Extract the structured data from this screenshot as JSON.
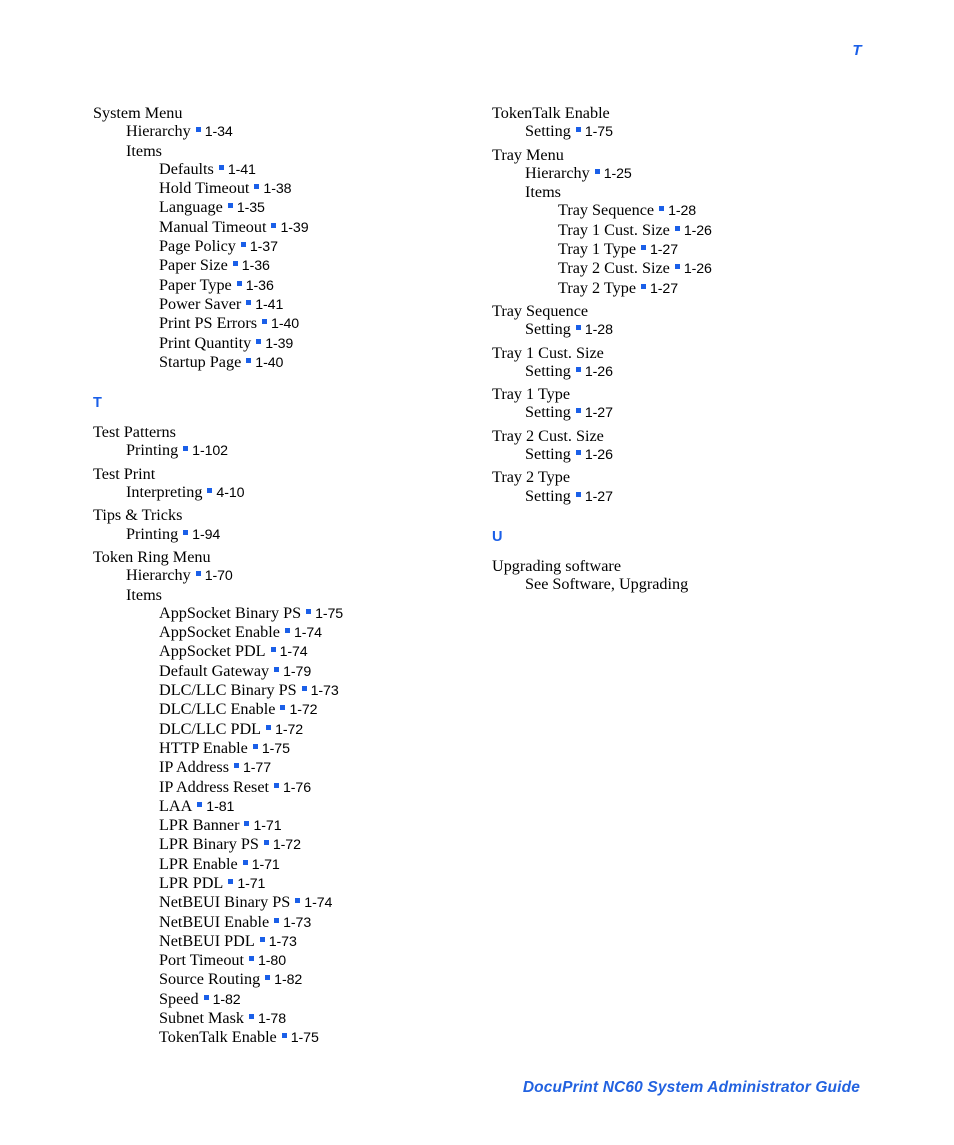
{
  "header": {
    "letter": "T"
  },
  "footer": {
    "text": "DocuPrint NC60 System Administrator Guide"
  },
  "columns": {
    "left": [
      {
        "type": "group",
        "name": "system-menu",
        "entries": [
          {
            "level": 0,
            "term": "System Menu",
            "locator": null
          },
          {
            "level": 1,
            "term": "Hierarchy",
            "locator": "1-34"
          },
          {
            "level": 1,
            "term": "Items",
            "locator": null
          },
          {
            "level": 2,
            "term": "Defaults",
            "locator": "1-41"
          },
          {
            "level": 2,
            "term": "Hold Timeout",
            "locator": "1-38"
          },
          {
            "level": 2,
            "term": "Language",
            "locator": "1-35"
          },
          {
            "level": 2,
            "term": "Manual Timeout",
            "locator": "1-39"
          },
          {
            "level": 2,
            "term": "Page Policy",
            "locator": "1-37"
          },
          {
            "level": 2,
            "term": "Paper Size",
            "locator": "1-36"
          },
          {
            "level": 2,
            "term": "Paper Type",
            "locator": "1-36"
          },
          {
            "level": 2,
            "term": "Power Saver",
            "locator": "1-41"
          },
          {
            "level": 2,
            "term": "Print PS Errors",
            "locator": "1-40"
          },
          {
            "level": 2,
            "term": "Print Quantity",
            "locator": "1-39"
          },
          {
            "level": 2,
            "term": "Startup Page",
            "locator": "1-40"
          }
        ]
      },
      {
        "type": "letter",
        "name": "section-letter-t",
        "letter": "T"
      },
      {
        "type": "group",
        "name": "test-patterns",
        "entries": [
          {
            "level": 0,
            "term": "Test Patterns",
            "locator": null
          },
          {
            "level": 1,
            "term": "Printing",
            "locator": "1-102"
          }
        ]
      },
      {
        "type": "group",
        "name": "test-print",
        "entries": [
          {
            "level": 0,
            "term": "Test Print",
            "locator": null
          },
          {
            "level": 1,
            "term": "Interpreting",
            "locator": "4-10"
          }
        ]
      },
      {
        "type": "group",
        "name": "tips-and-tricks",
        "entries": [
          {
            "level": 0,
            "term": "Tips & Tricks",
            "locator": null
          },
          {
            "level": 1,
            "term": "Printing",
            "locator": "1-94"
          }
        ]
      },
      {
        "type": "group",
        "name": "token-ring-menu",
        "entries": [
          {
            "level": 0,
            "term": "Token Ring Menu",
            "locator": null
          },
          {
            "level": 1,
            "term": "Hierarchy",
            "locator": "1-70"
          },
          {
            "level": 1,
            "term": "Items",
            "locator": null
          },
          {
            "level": 2,
            "term": "AppSocket Binary PS",
            "locator": "1-75"
          },
          {
            "level": 2,
            "term": "AppSocket Enable",
            "locator": "1-74"
          },
          {
            "level": 2,
            "term": "AppSocket PDL",
            "locator": "1-74"
          },
          {
            "level": 2,
            "term": "Default Gateway",
            "locator": "1-79"
          },
          {
            "level": 2,
            "term": "DLC/LLC Binary PS",
            "locator": "1-73"
          },
          {
            "level": 2,
            "term": "DLC/LLC Enable",
            "locator": "1-72"
          },
          {
            "level": 2,
            "term": "DLC/LLC PDL",
            "locator": "1-72"
          },
          {
            "level": 2,
            "term": "HTTP Enable",
            "locator": "1-75"
          },
          {
            "level": 2,
            "term": "IP Address",
            "locator": "1-77"
          },
          {
            "level": 2,
            "term": "IP Address Reset",
            "locator": "1-76"
          },
          {
            "level": 2,
            "term": "LAA",
            "locator": "1-81"
          },
          {
            "level": 2,
            "term": "LPR Banner",
            "locator": "1-71"
          },
          {
            "level": 2,
            "term": "LPR Binary PS",
            "locator": "1-72"
          },
          {
            "level": 2,
            "term": "LPR Enable",
            "locator": "1-71"
          },
          {
            "level": 2,
            "term": "LPR PDL",
            "locator": "1-71"
          },
          {
            "level": 2,
            "term": "NetBEUI Binary PS",
            "locator": "1-74"
          },
          {
            "level": 2,
            "term": "NetBEUI Enable",
            "locator": "1-73"
          },
          {
            "level": 2,
            "term": "NetBEUI PDL",
            "locator": "1-73"
          },
          {
            "level": 2,
            "term": "Port Timeout",
            "locator": "1-80"
          },
          {
            "level": 2,
            "term": "Source Routing",
            "locator": "1-82"
          },
          {
            "level": 2,
            "term": "Speed",
            "locator": "1-82"
          },
          {
            "level": 2,
            "term": "Subnet Mask",
            "locator": "1-78"
          },
          {
            "level": 2,
            "term": "TokenTalk Enable",
            "locator": "1-75"
          }
        ]
      }
    ],
    "right": [
      {
        "type": "group",
        "name": "tokentalk-enable",
        "entries": [
          {
            "level": 0,
            "term": "TokenTalk Enable",
            "locator": null
          },
          {
            "level": 1,
            "term": "Setting",
            "locator": "1-75"
          }
        ]
      },
      {
        "type": "group",
        "name": "tray-menu",
        "entries": [
          {
            "level": 0,
            "term": "Tray Menu",
            "locator": null
          },
          {
            "level": 1,
            "term": "Hierarchy",
            "locator": "1-25"
          },
          {
            "level": 1,
            "term": "Items",
            "locator": null
          },
          {
            "level": 2,
            "term": "Tray Sequence",
            "locator": "1-28"
          },
          {
            "level": 2,
            "term": "Tray 1 Cust. Size",
            "locator": "1-26"
          },
          {
            "level": 2,
            "term": "Tray 1 Type",
            "locator": "1-27"
          },
          {
            "level": 2,
            "term": "Tray 2 Cust. Size",
            "locator": "1-26"
          },
          {
            "level": 2,
            "term": "Tray 2 Type",
            "locator": "1-27"
          }
        ]
      },
      {
        "type": "group",
        "name": "tray-sequence",
        "entries": [
          {
            "level": 0,
            "term": "Tray Sequence",
            "locator": null
          },
          {
            "level": 1,
            "term": "Setting",
            "locator": "1-28"
          }
        ]
      },
      {
        "type": "group",
        "name": "tray-1-cust-size",
        "entries": [
          {
            "level": 0,
            "term": "Tray 1 Cust. Size",
            "locator": null
          },
          {
            "level": 1,
            "term": "Setting",
            "locator": "1-26"
          }
        ]
      },
      {
        "type": "group",
        "name": "tray-1-type",
        "entries": [
          {
            "level": 0,
            "term": "Tray 1 Type",
            "locator": null
          },
          {
            "level": 1,
            "term": "Setting",
            "locator": "1-27"
          }
        ]
      },
      {
        "type": "group",
        "name": "tray-2-cust-size",
        "entries": [
          {
            "level": 0,
            "term": "Tray 2 Cust. Size",
            "locator": null
          },
          {
            "level": 1,
            "term": "Setting",
            "locator": "1-26"
          }
        ]
      },
      {
        "type": "group",
        "name": "tray-2-type",
        "entries": [
          {
            "level": 0,
            "term": "Tray 2 Type",
            "locator": null
          },
          {
            "level": 1,
            "term": "Setting",
            "locator": "1-27"
          }
        ]
      },
      {
        "type": "letter",
        "name": "section-letter-u",
        "letter": "U"
      },
      {
        "type": "group",
        "name": "upgrading-software",
        "entries": [
          {
            "level": 0,
            "term": "Upgrading software",
            "locator": null
          },
          {
            "level": 1,
            "term": "See Software, Upgrading",
            "locator": null,
            "seealso": true
          }
        ]
      }
    ]
  },
  "colors": {
    "accent_blue": "#1a5fe8",
    "footer_blue": "#2262e0",
    "body_text": "#000000",
    "page_background": "#ffffff"
  }
}
